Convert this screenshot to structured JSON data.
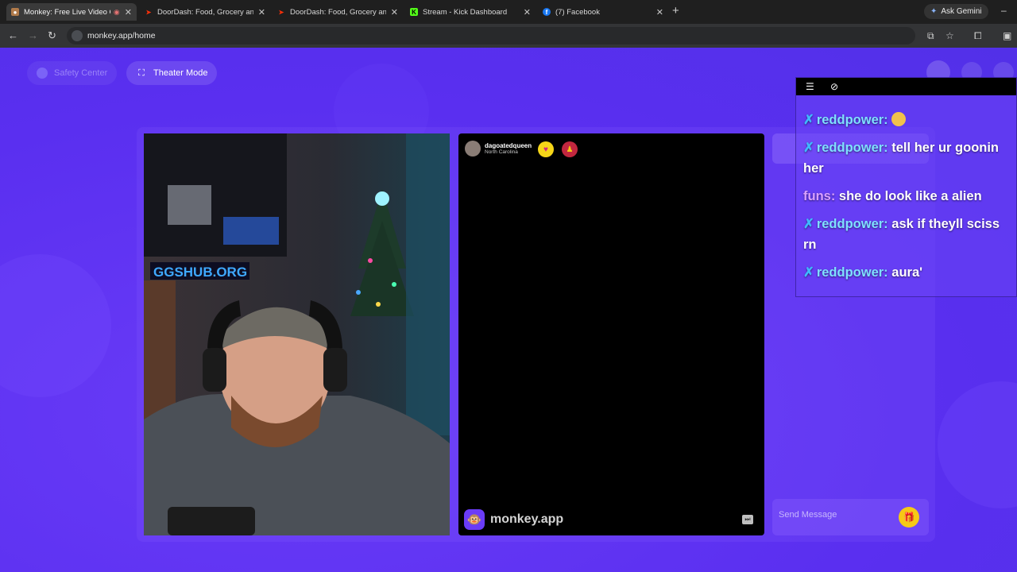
{
  "browser": {
    "tabs": [
      {
        "title": "Monkey: Free Live Video Ch",
        "active": true,
        "favicon_icon": "monkey-icon"
      },
      {
        "title": "DoorDash: Food, Grocery and M",
        "active": false,
        "favicon_icon": "doordash-icon"
      },
      {
        "title": "DoorDash: Food, Grocery and M",
        "active": false,
        "favicon_icon": "doordash-icon"
      },
      {
        "title": "Stream - Kick Dashboard",
        "active": false,
        "favicon_icon": "kick-icon"
      },
      {
        "title": "(7) Facebook",
        "active": false,
        "favicon_icon": "facebook-icon"
      }
    ],
    "gemini_label": "Ask Gemini",
    "url": "monkey.app/home"
  },
  "page": {
    "safety_center": "Safety Center",
    "theater_mode": "Theater Mode",
    "peer": {
      "username": "dagoatedqueen",
      "location": "North Carolina"
    },
    "brand": "monkey.app",
    "send_placeholder": "Send Message"
  },
  "stream_chat": {
    "messages": [
      {
        "user": "reddpower:",
        "text": "",
        "emote": true
      },
      {
        "user": "reddpower:",
        "text": "tell her ur goonin",
        "cont": "her"
      },
      {
        "user": "funs:",
        "text": "she do look like a alien",
        "purple": true
      },
      {
        "user": "reddpower:",
        "text": "ask if theyll sciss",
        "cont": "rn"
      },
      {
        "user": "reddpower:",
        "text": "aura'"
      }
    ]
  },
  "colors": {
    "page_bg": "#5a2ff0",
    "gift": "#f6c915",
    "chat_user": "#7fe0ff"
  }
}
